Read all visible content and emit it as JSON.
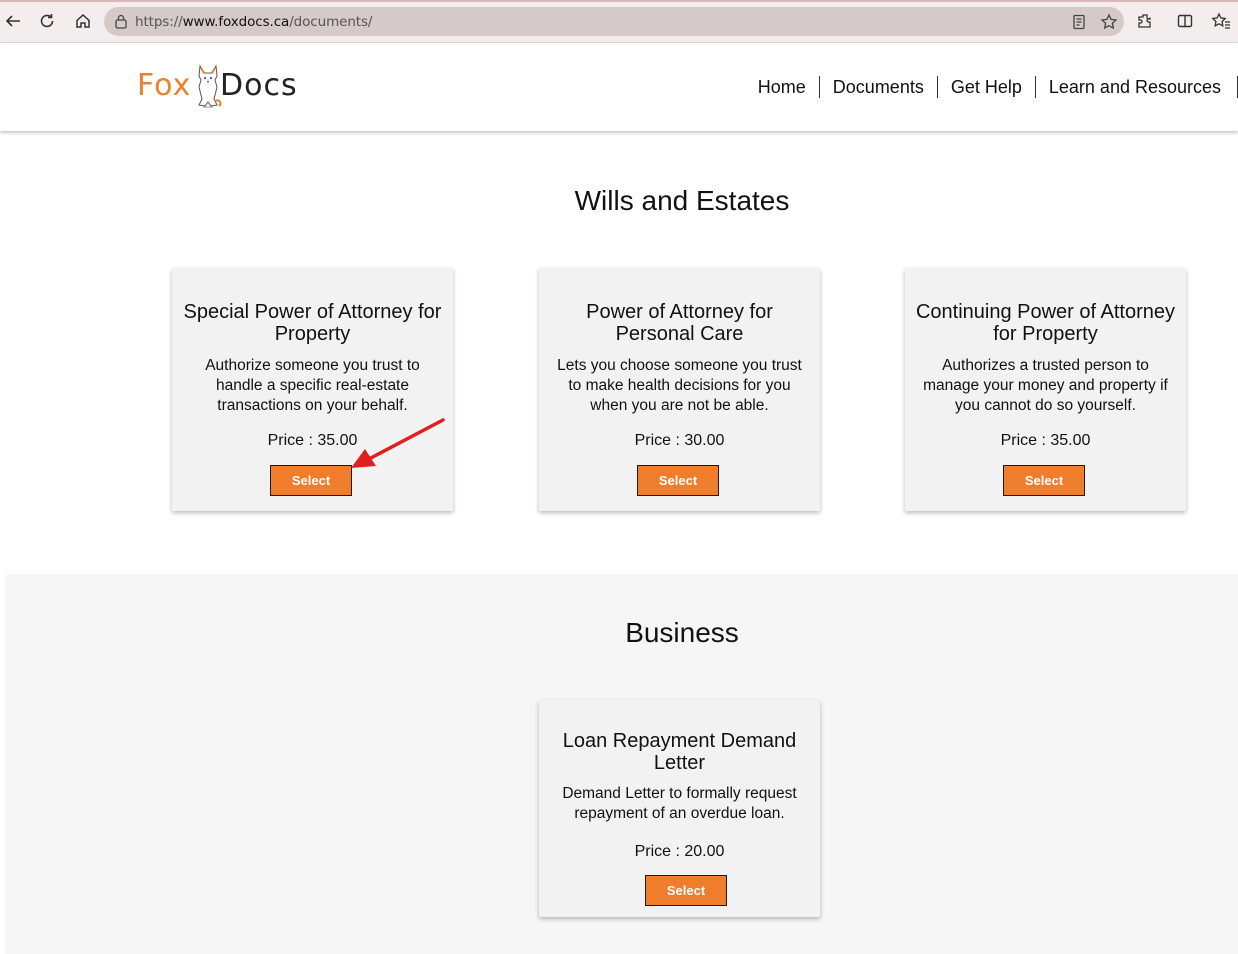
{
  "browser": {
    "url_scheme": "https://",
    "url_host": "www.foxdocs.ca",
    "url_path": "/documents/"
  },
  "header": {
    "logo_fox": "Fox",
    "logo_docs": "Docs",
    "nav": [
      {
        "label": "Home"
      },
      {
        "label": "Documents"
      },
      {
        "label": "Get Help"
      },
      {
        "label": "Learn and Resources"
      }
    ]
  },
  "sections": [
    {
      "title": "Wills and Estates",
      "cards": [
        {
          "title": "Special Power of Attorney for Property",
          "description": "Authorize someone you trust to handle a specific real-estate transactions on your behalf.",
          "price": "Price : 35.00",
          "button": "Select"
        },
        {
          "title": "Power of Attorney for Personal Care",
          "description": "Lets you choose someone you trust to make health decisions for you when you are not be able.",
          "price": "Price : 30.00",
          "button": "Select"
        },
        {
          "title": "Continuing Power of Attorney for Property",
          "description": "Authorizes a trusted person to manage your money and property if you cannot do so yourself.",
          "price": "Price : 35.00",
          "button": "Select"
        }
      ]
    },
    {
      "title": "Business",
      "cards": [
        {
          "title": "Loan Repayment Demand Letter",
          "description": "Demand Letter to formally request repayment of an overdue loan.",
          "price": "Price : 20.00",
          "button": "Select"
        }
      ]
    }
  ],
  "colors": {
    "accent": "#f07d2c",
    "brand_fox": "#e7822f",
    "annotation_arrow": "#e02020"
  }
}
